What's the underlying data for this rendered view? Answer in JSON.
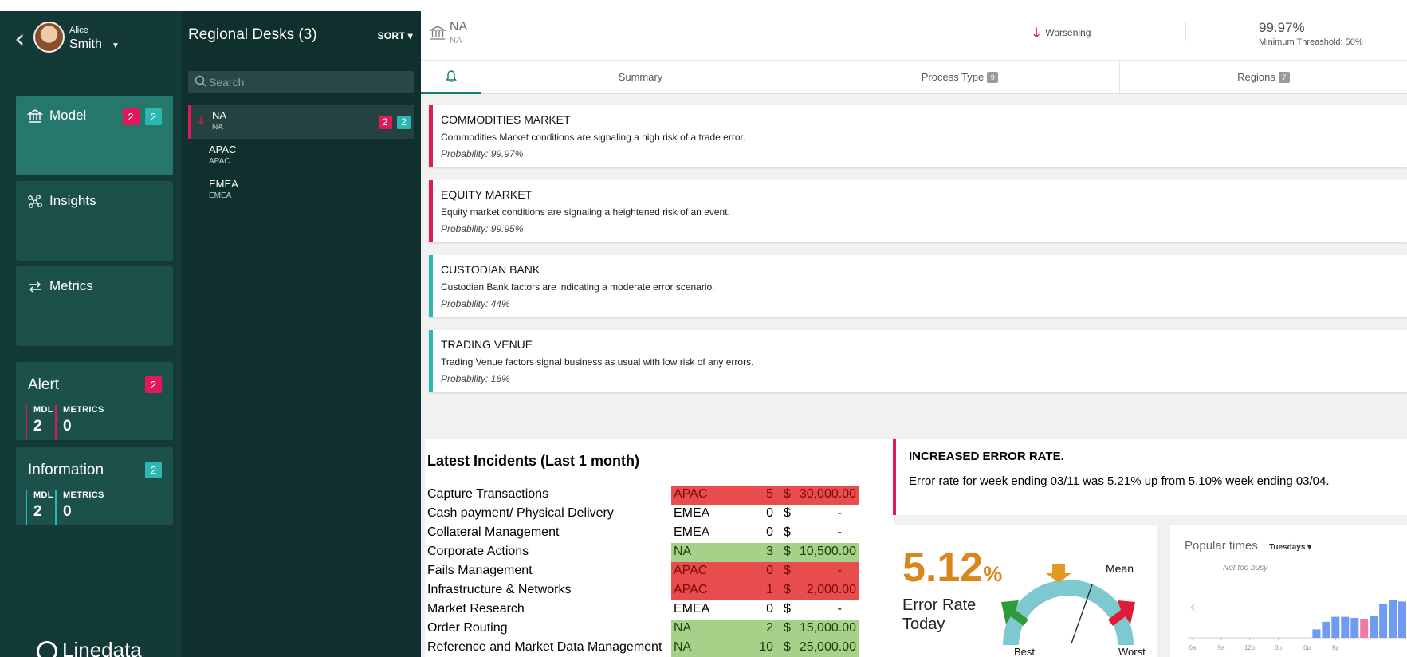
{
  "user": {
    "first_name": "Alice",
    "last_name": "Smith"
  },
  "nav": {
    "items": [
      {
        "label": "Model",
        "badges": [
          "2",
          "2"
        ]
      },
      {
        "label": "Insights"
      },
      {
        "label": "Metrics"
      }
    ],
    "alert": {
      "title": "Alert",
      "badge": "2",
      "mdl_label": "MDL",
      "metrics_label": "METRICS",
      "mdl": "2",
      "metrics": "0"
    },
    "information": {
      "title": "Information",
      "badge": "2",
      "mdl_label": "MDL",
      "metrics_label": "METRICS",
      "mdl": "2",
      "metrics": "0"
    },
    "logo": "Linedata"
  },
  "regions": {
    "title": "Regional Desks (3)",
    "sort_label": "SORT",
    "search_placeholder": "Search",
    "items": [
      {
        "name": "NA",
        "sub": "NA",
        "badges": [
          "2",
          "2"
        ]
      },
      {
        "name": "APAC",
        "sub": "APAC"
      },
      {
        "name": "EMEA",
        "sub": "EMEA"
      }
    ]
  },
  "header": {
    "name": "NA",
    "sub": "NA",
    "trend": "Worsening",
    "percent": "99.97%",
    "threshold": "Minimum Threashold: 50%"
  },
  "tabs": [
    {
      "label": "Summary"
    },
    {
      "label": "Process Type",
      "count": "9"
    },
    {
      "label": "Regions",
      "count": "7"
    }
  ],
  "alerts": [
    {
      "title": "COMMODITIES MARKET",
      "desc": "Commodities Market conditions are signaling a high risk of a trade error.",
      "prob": "Probability: 99.97%"
    },
    {
      "title": "EQUITY MARKET",
      "desc": "Equity market conditions are signaling a heightened risk of an event.",
      "prob": "Probability: 99.95%"
    },
    {
      "title": "CUSTODIAN BANK",
      "desc": "Custodian Bank factors are indicating a moderate error scenario.",
      "prob": "Probability: 44%"
    },
    {
      "title": "TRADING VENUE",
      "desc": "Trading Venue factors signal business as usual with low risk of any errors.",
      "prob": "Probability: 16%"
    }
  ],
  "incidents": {
    "title": "Latest Incidents (Last 1 month)",
    "rows": [
      {
        "name": "Capture Transactions",
        "region": "APAC",
        "count": "5",
        "dollar": "$",
        "amount": "30,000.00"
      },
      {
        "name": "Cash payment/ Physical Delivery",
        "region": "EMEA",
        "count": "0",
        "dollar": "$",
        "amount": "-"
      },
      {
        "name": "Collateral Management",
        "region": "EMEA",
        "count": "0",
        "dollar": "$",
        "amount": "-"
      },
      {
        "name": "Corporate Actions",
        "region": "NA",
        "count": "3",
        "dollar": "$",
        "amount": "10,500.00"
      },
      {
        "name": "Fails Management",
        "region": "APAC",
        "count": "0",
        "dollar": "$",
        "amount": "-"
      },
      {
        "name": "Infrastructure & Networks",
        "region": "APAC",
        "count": "1",
        "dollar": "$",
        "amount": "2,000.00"
      },
      {
        "name": "Market Research",
        "region": "EMEA",
        "count": "0",
        "dollar": "$",
        "amount": "-"
      },
      {
        "name": "Order Routing",
        "region": "NA",
        "count": "2",
        "dollar": "$",
        "amount": "15,000.00"
      },
      {
        "name": "Reference and Market Data Management",
        "region": "NA",
        "count": "10",
        "dollar": "$",
        "amount": "25,000.00"
      }
    ]
  },
  "error_card": {
    "title": "INCREASED ERROR RATE.",
    "desc": "Error rate for week ending 03/11 was 5.21% up from 5.10% week ending 03/04."
  },
  "error_rate": {
    "value": "5.12",
    "unit": "%",
    "label_line1": "Error Rate",
    "label_line2": "Today",
    "mean_label": "Mean",
    "best_label": "Best",
    "worst_label": "Worst"
  },
  "popular_times": {
    "title": "Popular times",
    "day": "Tuesdays",
    "busy_note": "Not too busy",
    "ticks": [
      "6a",
      "9a",
      "12p",
      "3p",
      "6p",
      "9p"
    ],
    "bars": [
      0,
      0,
      0,
      0,
      0,
      0,
      0,
      0,
      0,
      0,
      0,
      0,
      0,
      0.22,
      0.42,
      0.55,
      0.55,
      0.52,
      0.5,
      0.58,
      0.88,
      1.0,
      0.95
    ]
  },
  "colors": {
    "alert_red": "#e2185b",
    "teal": "#2ab8b0",
    "rate_orange": "#d9861c"
  }
}
